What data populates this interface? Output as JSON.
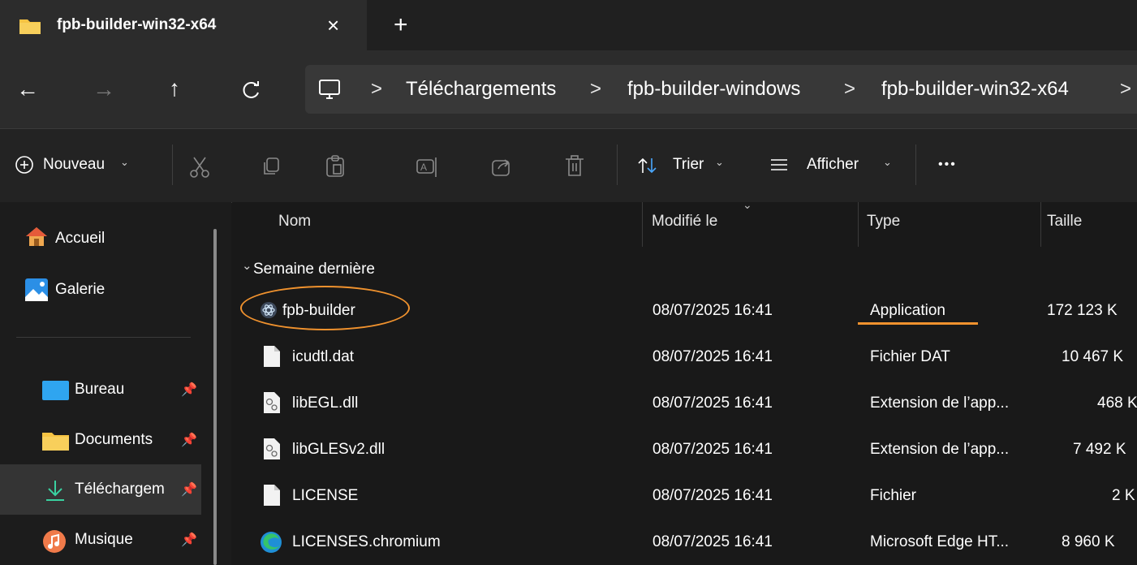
{
  "tab": {
    "title": "fpb-builder-win32-x64",
    "close": "×",
    "new_tab": "+"
  },
  "nav": {
    "back": "←",
    "forward": "→",
    "up": "↑",
    "refresh": "C"
  },
  "breadcrumb": {
    "items": [
      "Téléchargements",
      "fpb-builder-windows",
      "fpb-builder-win32-x64"
    ],
    "separator": ">"
  },
  "toolbar": {
    "new_label": "Nouveau",
    "sort_label": "Trier",
    "view_label": "Afficher",
    "more": "•••"
  },
  "sidebar": {
    "items": [
      {
        "label": "Accueil"
      },
      {
        "label": "Galerie"
      },
      {
        "label": "Bureau"
      },
      {
        "label": "Documents"
      },
      {
        "label": "Téléchargem"
      },
      {
        "label": "Musique"
      }
    ]
  },
  "columns": {
    "name": "Nom",
    "modified": "Modifié le",
    "type": "Type",
    "size": "Taille"
  },
  "group": {
    "label": "Semaine dernière"
  },
  "files": [
    {
      "name": "fpb-builder",
      "modified": "08/07/2025 16:41",
      "type": "Application",
      "size": "172 123 K"
    },
    {
      "name": "icudtl.dat",
      "modified": "08/07/2025 16:41",
      "type": "Fichier DAT",
      "size": "10 467 K"
    },
    {
      "name": "libEGL.dll",
      "modified": "08/07/2025 16:41",
      "type": "Extension de l’app...",
      "size": "468 K"
    },
    {
      "name": "libGLESv2.dll",
      "modified": "08/07/2025 16:41",
      "type": "Extension de l’app...",
      "size": "7 492 K"
    },
    {
      "name": "LICENSE",
      "modified": "08/07/2025 16:41",
      "type": "Fichier",
      "size": "2 K"
    },
    {
      "name": "LICENSES.chromium",
      "modified": "08/07/2025 16:41",
      "type": "Microsoft Edge HT...",
      "size": "8 960 K"
    }
  ],
  "colors": {
    "accent": "#f0922e",
    "folder": "#f6c343"
  }
}
